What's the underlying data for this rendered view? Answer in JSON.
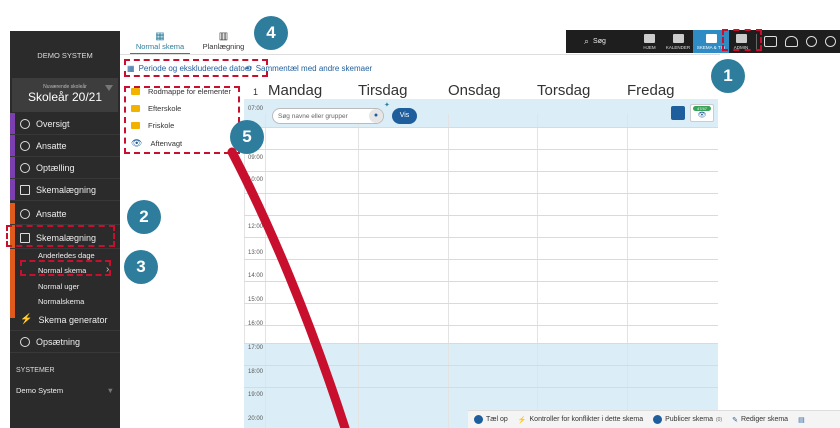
{
  "sidebar": {
    "system_name": "DEMO SYSTEM",
    "school_year_label": "Nuværende skoleår",
    "school_year": "Skoleår 20/21",
    "section1": [
      "Oversigt",
      "Ansatte",
      "Optælling",
      "Skemalægning"
    ],
    "section2": [
      "Ansatte",
      "Skemalægning"
    ],
    "sub_items": [
      "Anderledes dage",
      "Normal skema",
      "Normal uger",
      "Normalskema"
    ],
    "generator": "Skema generator",
    "settings": "Opsætning",
    "systems_header": "SYSTEMER",
    "systems_value": "Demo System"
  },
  "tabs": [
    {
      "label": "Normal skema",
      "icon": "calendar-icon"
    },
    {
      "label": "Planlægning",
      "icon": "grid-icon"
    }
  ],
  "toolbar": {
    "period_label": "Periode og ekskluderede datoer",
    "compare_label": "Sammentæl med andre skemaer"
  },
  "folders": {
    "root": "Rodmappe for elementer",
    "items": [
      "Efterskole",
      "Friskole"
    ],
    "watch": "Aftenvagt"
  },
  "week_number": "1",
  "days": [
    "Mandag",
    "Tirsdag",
    "Onsdag",
    "Torsdag",
    "Fredag"
  ],
  "times": [
    "07:00",
    "09:00",
    "10:00",
    "12:00",
    "13:00",
    "14:00",
    "15:00",
    "16:00",
    "17:00",
    "18:00",
    "19:00",
    "20:00"
  ],
  "search": {
    "placeholder": "Søg navne eller grupper",
    "button": "Vis",
    "badge": "47/47"
  },
  "topnav": {
    "search_label": "Søg",
    "items": [
      "HJEM",
      "KALENDER",
      "SKEMA & TID",
      "ADMIN"
    ]
  },
  "bottom_toolbar": [
    "Tæl op",
    "Kontroller for konflikter i dette skema",
    "Publicer skema",
    "Rediger skema"
  ],
  "publish_count": "(0)",
  "callouts": [
    "1",
    "2",
    "3",
    "4",
    "5"
  ],
  "colors": {
    "accent": "#2e7d9c",
    "callout_border": "#c8102e",
    "arrow": "#c8102e",
    "sidebar": "#2b2b2b"
  }
}
